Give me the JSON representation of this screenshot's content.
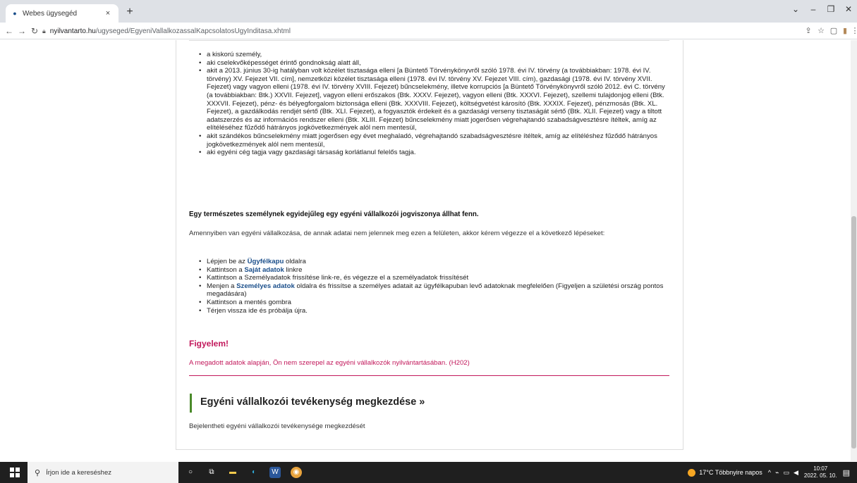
{
  "browser": {
    "tab_title": "Webes ügysegéd",
    "tab_close": "×",
    "new_tab": "+",
    "url_host": "nyilvantarto.hu",
    "url_path": "/ugyseged/EgyeniVallalkozassalKapcsolatosUgyInditasa.xhtml"
  },
  "content": {
    "bullets": [
      "a kiskorú személy,",
      "aki cselekvőképességet érintő gondnokság alatt áll,",
      "akit a 2013. június 30-ig hatályban volt közélet tisztasága elleni [a Büntető Törvénykönyvről szóló 1978. évi IV. törvény (a továbbiakban: 1978. évi IV. törvény) XV. Fejezet VII. cím], nemzetközi közélet tisztasága elleni (1978. évi IV. törvény XV. Fejezet VIII. cím), gazdasági (1978. évi IV. törvény XVII. Fejezet) vagy vagyon elleni (1978. évi IV. törvény XVIII. Fejezet) bűncselekmény, illetve korrupciós [a Büntető Törvénykönyvről szóló 2012. évi C. törvény (a továbbiakban: Btk.) XXVII. Fejezet], vagyon elleni erőszakos (Btk. XXXV. Fejezet), vagyon elleni (Btk. XXXVI. Fejezet), szellemi tulajdonjog elleni (Btk. XXXVII. Fejezet), pénz- és bélyegforgalom biztonsága elleni (Btk. XXXVIII. Fejezet), költségvetést károsító (Btk. XXXIX. Fejezet), pénzmosás (Btk. XL. Fejezet), a gazdálkodás rendjét sértő (Btk. XLI. Fejezet), a fogyasztók érdekeit és a gazdasági verseny tisztaságát sértő (Btk. XLII. Fejezet) vagy a tiltott adatszerzés és az információs rendszer elleni (Btk. XLIII. Fejezet) bűncselekmény miatt jogerősen végrehajtandó szabadságvesztésre ítéltek, amíg az elítéléséhez fűződő hátrányos jogkövetkezmények alól nem mentesül,",
      "akit szándékos bűncselekmény miatt jogerősen egy évet meghaladó, végrehajtandó szabadságvesztésre ítéltek, amíg az elítéléshez fűződő hátrányos jogkövetkezmények alól nem mentesül,",
      "aki egyéni cég tagja vagy gazdasági társaság korlátlanul felelős tagja."
    ],
    "bold_note": "Egy természetes személynek egyidejűleg egy egyéni vállalkozói jogviszonya állhat fenn.",
    "intro": "Amennyiben van egyéni vállalkozása, de annak adatai nem jelennek meg ezen a felületen, akkor kérem végezze el a következő lépéseket:",
    "steps": {
      "s1_pre": "Lépjen be az ",
      "s1_link": "Ügyfélkapu",
      "s1_post": " oldalra",
      "s2_pre": "Kattintson a ",
      "s2_link": "Saját adatok",
      "s2_post": " linkre",
      "s3": "Kattintson a Személyadatok frissítése link-re, és végezze el a személyadatok frissítését",
      "s4_pre": "Menjen a ",
      "s4_link": "Személyes adatok",
      "s4_post": " oldalra és frissítse a személyes adatait az ügyfélkapuban levő adatoknak megfelelően (Figyeljen a születési ország pontos megadására)",
      "s5": "Kattintson a mentés gombra",
      "s6": "Térjen vissza ide és próbálja újra."
    },
    "warning_title": "Figyelem!",
    "warning_text": "A megadott adatok alapján, Ön nem szerepel az egyéni vállalkozók nyilvántartásában. (H202)",
    "section_title": "Egyéni vállalkozói tevékenység megkezdése  »",
    "section_desc": "Bejelentheti egyéni vállalkozói tevékenysége megkezdését"
  },
  "taskbar": {
    "search_placeholder": "Írjon ide a kereséshez",
    "weather": "17°C  Többnyire napos",
    "time": "10:07",
    "date": "2022. 05. 10."
  },
  "colors": {
    "link": "#1a4e8a",
    "warning": "#c2185b",
    "section_accent": "#4a8a2a"
  }
}
